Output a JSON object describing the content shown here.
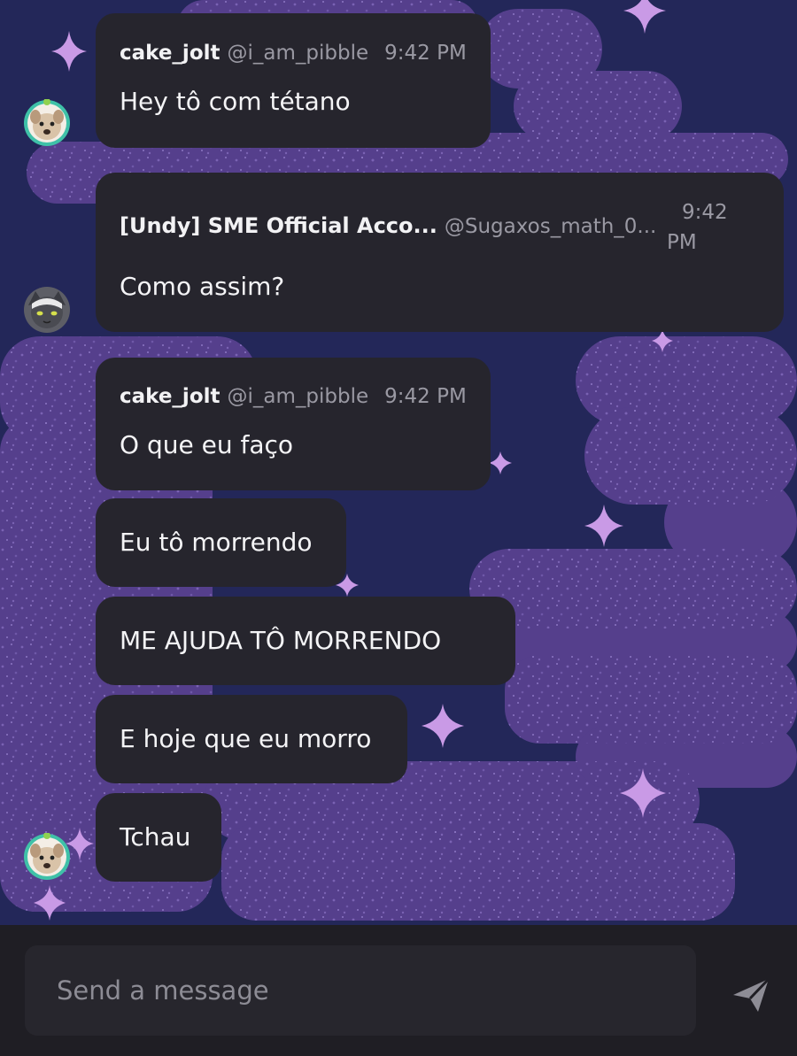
{
  "theme": {
    "background": "#232759",
    "cloud_color": "#5b4391",
    "star_color": "#c99ae6",
    "bubble_color": "#26252d",
    "text_color": "#f2f2f4",
    "muted_text_color": "#9a99a3",
    "composer_color": "#1f1e24"
  },
  "messages": [
    {
      "username": "cake_jolt",
      "handle": "@i_am_pibble",
      "time": "9:42 PM",
      "avatar_icon": "dog-avatar-icon",
      "texts": [
        "Hey tô com tétano"
      ]
    },
    {
      "username": "[Undy] SME Official Acco...",
      "handle": "@Sugaxos_math_0...",
      "time_line1": "9:42",
      "time_line2": "PM",
      "avatar_icon": "cat-avatar-icon",
      "texts": [
        "Como assim?"
      ]
    },
    {
      "username": "cake_jolt",
      "handle": "@i_am_pibble",
      "time": "9:42 PM",
      "avatar_icon": "dog-avatar-icon",
      "texts": [
        "O que eu faço",
        "Eu tô morrendo",
        "ME AJUDA TÔ MORRENDO",
        "E hoje que eu morro",
        "Tchau"
      ]
    }
  ],
  "composer": {
    "placeholder": "Send a message",
    "value": "",
    "send_icon": "send-icon"
  }
}
